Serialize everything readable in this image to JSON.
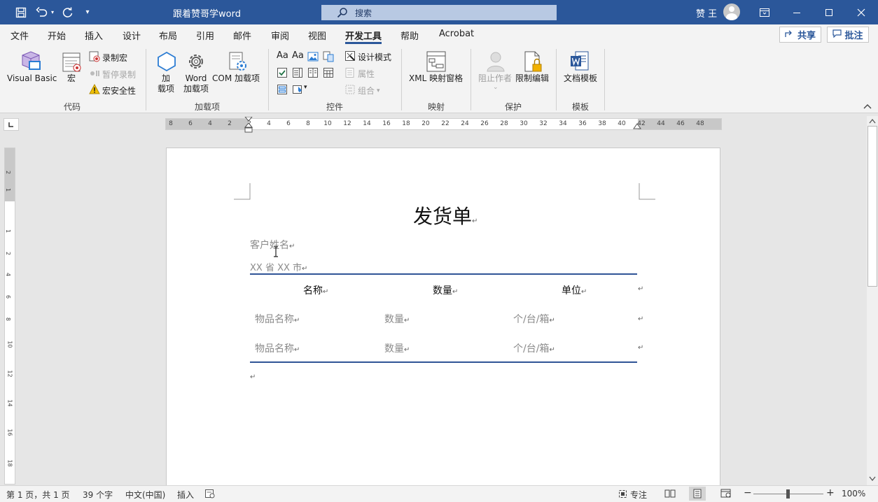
{
  "window": {
    "title": "跟着赞哥学word",
    "search_placeholder": "搜索",
    "user_name": "赞 王"
  },
  "menu": {
    "tabs": [
      "文件",
      "开始",
      "插入",
      "设计",
      "布局",
      "引用",
      "邮件",
      "审阅",
      "视图",
      "开发工具",
      "帮助",
      "Acrobat"
    ],
    "active_tab": "开发工具",
    "share_label": "共享",
    "comment_label": "批注"
  },
  "ribbon": {
    "code": {
      "group_label": "代码",
      "visual_basic": "Visual Basic",
      "macro": "宏",
      "record_macro": "录制宏",
      "pause_recording": "暂停录制",
      "macro_security": "宏安全性"
    },
    "addins": {
      "group_label": "加载项",
      "addin_line1": "加",
      "addin_line2": "载项",
      "word_addin_line1": "Word",
      "word_addin_line2": "加载项",
      "com_addin": "COM 加载项"
    },
    "controls": {
      "group_label": "控件",
      "design_mode": "设计模式",
      "properties": "属性",
      "group": "组合",
      "aa1": "Aa",
      "aa2": "Aa"
    },
    "mapping": {
      "group_label": "映射",
      "xml_pane": "XML 映射窗格"
    },
    "protect": {
      "group_label": "保护",
      "block_authors": "阻止作者",
      "restrict_editing": "限制编辑"
    },
    "templates": {
      "group_label": "模板",
      "document_template": "文档模板"
    }
  },
  "ruler": {
    "h_numbers": [
      "8",
      "6",
      "4",
      "2",
      "2",
      "4",
      "6",
      "8",
      "10",
      "12",
      "14",
      "16",
      "18",
      "20",
      "22",
      "24",
      "26",
      "28",
      "30",
      "32",
      "34",
      "36",
      "38",
      "40",
      "42",
      "44",
      "46",
      "48"
    ],
    "v_numbers": [
      "2",
      "1",
      "1",
      "2",
      "4",
      "6",
      "8",
      "10",
      "12",
      "14",
      "16",
      "18"
    ]
  },
  "document": {
    "title": "发货单",
    "customer_name": "客户姓名",
    "address": "XX 省 XX 市",
    "table": {
      "headers": [
        "名称",
        "数量",
        "单位"
      ],
      "rows": [
        [
          "物品名称",
          "数量",
          "个/台/箱"
        ],
        [
          "物品名称",
          "数量",
          "个/台/箱"
        ]
      ]
    },
    "paragraph_mark": "↵"
  },
  "status": {
    "page": "第 1 页，共 1 页",
    "words": "39 个字",
    "language": "中文(中国)",
    "mode": "插入",
    "focus": "专注",
    "zoom": "100%",
    "zoom_minus": "−",
    "zoom_plus": "+"
  },
  "colors": {
    "title_bar": "#2b579a",
    "accent_line": "#2f5496"
  }
}
